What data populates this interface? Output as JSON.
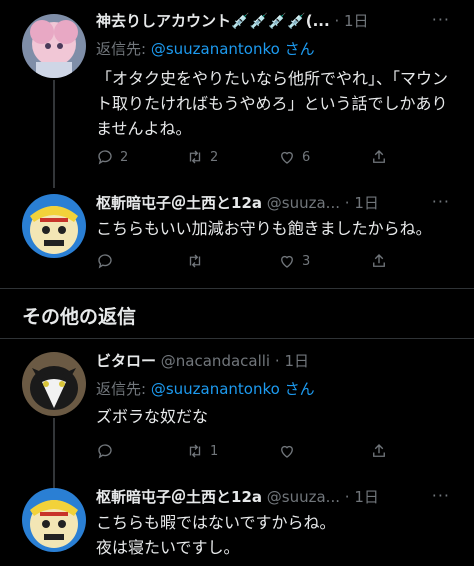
{
  "tweets": [
    {
      "name": "神去りしアカウント💉💉💉💉(...",
      "handle": "",
      "dot": "·",
      "time": "1日",
      "reply_prefix": "返信先: ",
      "reply_mention": "@suuzanantonko",
      "reply_suffix": " さん",
      "text": "「オタク史をやりたいなら他所でやれ」、「マウント取りたければもうやめろ」という話でしかありませんよね。",
      "counts": {
        "reply": "2",
        "retweet": "2",
        "like": "6"
      }
    },
    {
      "name": "枢斬暗屯子＠土西と12a",
      "handle": "@suuza...",
      "dot": "·",
      "time": "1日",
      "text": "こちらもいい加減お守りも飽きましたからね。",
      "counts": {
        "reply": "",
        "retweet": "",
        "like": "3"
      }
    },
    {
      "name": "ビタロー",
      "handle": "@nacandacalli",
      "dot": "·",
      "time": "1日",
      "reply_prefix": "返信先: ",
      "reply_mention": "@suuzanantonko",
      "reply_suffix": " さん",
      "text": "ズボラな奴だな",
      "counts": {
        "reply": "",
        "retweet": "1",
        "like": ""
      }
    },
    {
      "name": "枢斬暗屯子＠土西と12a",
      "handle": "@suuza...",
      "dot": "·",
      "time": "1日",
      "text": "こちらも暇ではないですからね。\n夜は寝たいですし。",
      "counts": {
        "reply": "",
        "retweet": "",
        "like": ""
      }
    }
  ],
  "section": {
    "title": "その他の返信"
  },
  "more_glyph": "···",
  "colors": {
    "accent": "#1d9bf0",
    "muted": "#71767b",
    "text": "#e7e9ea",
    "bg": "#000000"
  },
  "icons": [
    "reply-icon",
    "retweet-icon",
    "like-icon",
    "share-icon",
    "more-icon"
  ]
}
